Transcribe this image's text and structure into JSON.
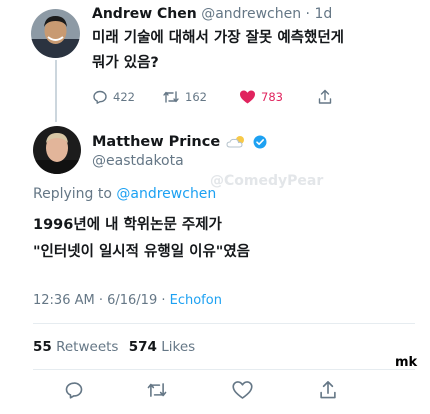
{
  "tweet1": {
    "name": "Andrew Chen",
    "meta": "@andrewchen · 1d",
    "text_line1": "미래 기술에 대해서 가장 잘못 예측했던게",
    "text_line2": "뭐가 있음?",
    "replies": "422",
    "retweets": "162",
    "likes": "783"
  },
  "tweet2": {
    "name": "Matthew Prince",
    "handle": "@eastdakota",
    "replying_prefix": "Replying to ",
    "replying_handle": "@andrewchen",
    "text_line1": "1996년에 내 학위논문 주제가",
    "text_line2": "\"인터넷이 일시적 유행일 이유\"였음",
    "time": "12:36 AM · 6/16/19 · ",
    "client": "Echofon",
    "retweet_count": "55",
    "retweet_label": "Retweets",
    "like_count": "574",
    "like_label": "Likes"
  },
  "watermark": "@ComedyPear",
  "corner_mark": "mk",
  "colors": {
    "link": "#1da1f2",
    "like": "#e0245e",
    "muted": "#657786",
    "text": "#14171a",
    "divider": "#e6ecf0"
  },
  "icons": [
    "reply-icon",
    "retweet-icon",
    "heart-icon",
    "share-icon",
    "verified-icon",
    "cloud-icon"
  ]
}
